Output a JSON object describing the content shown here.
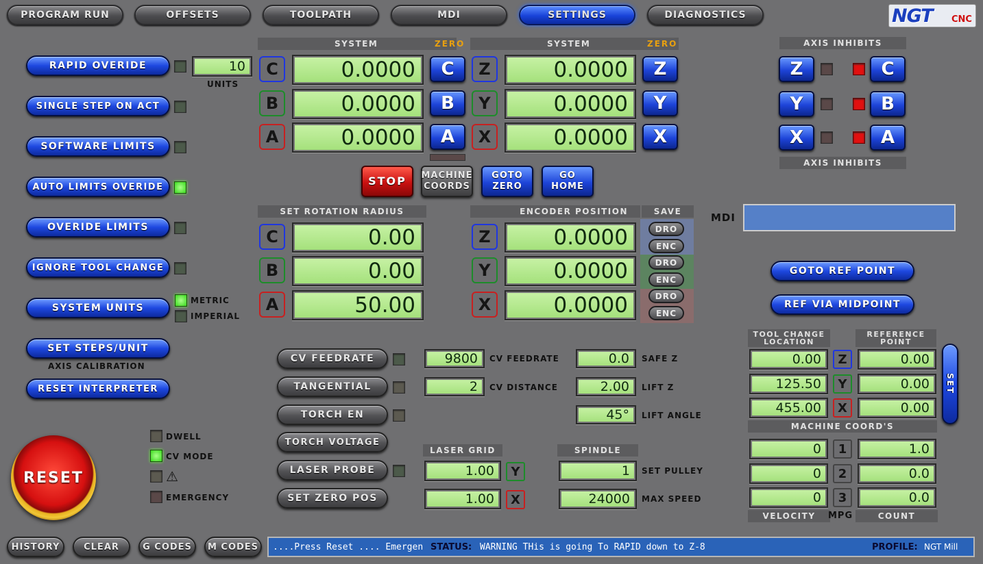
{
  "tabs": [
    "PROGRAM RUN",
    "OFFSETS",
    "TOOLPATH",
    "MDI",
    "SETTINGS",
    "DIAGNOSTICS"
  ],
  "logo": {
    "brand": "NGT",
    "sub": "CNC"
  },
  "left_buttons": [
    "RAPID OVERIDE",
    "SINGLE STEP ON ACT",
    "SOFTWARE LIMITS",
    "AUTO LIMITS OVERIDE",
    "OVERIDE LIMITS",
    "IGNORE TOOL CHANGE",
    "SYSTEM UNITS",
    "SET STEPS/UNIT",
    "RESET INTERPRETER"
  ],
  "rapid_value": "10",
  "units_label": "UNITS",
  "metric": "METRIC",
  "imperial": "IMPERIAL",
  "axis_calibration": "AXIS CALIBRATION",
  "system_label": "SYSTEM",
  "zero_label": "ZERO",
  "axes_left": [
    "C",
    "B",
    "A"
  ],
  "axes_right": [
    "Z",
    "Y",
    "X"
  ],
  "dro_left": [
    "0.0000",
    "0.0000",
    "0.0000"
  ],
  "dro_right": [
    "0.0000",
    "0.0000",
    "0.0000"
  ],
  "axis_inhibits": "AXIS INHIBITS",
  "buttons_mid": {
    "stop": "STOP",
    "machine": "MACHINE COORDS",
    "goto_zero": "GOTO ZERO",
    "go_home": "GO HOME"
  },
  "rotation_hdr": "SET ROTATION RADIUS",
  "rotation_vals": [
    "0.00",
    "0.00",
    "50.00"
  ],
  "encoder_hdr": "ENCODER POSITION",
  "save_hdr": "SAVE",
  "encoder_vals": [
    "0.0000",
    "0.0000",
    "0.0000"
  ],
  "dro_btn": "DRO",
  "enc_btn": "ENC",
  "mdi_label": "MDI",
  "goto_ref": "GOTO REF POINT",
  "ref_mid": "REF VIA MIDPOINT",
  "mid_buttons": [
    "CV FEEDRATE",
    "TANGENTIAL",
    "TORCH EN",
    "TORCH VOLTAGE",
    "LASER PROBE",
    "SET ZERO POS"
  ],
  "cv_feedrate_val": "9800",
  "cv_feedrate_lbl": "CV FEEDRATE",
  "cv_distance_val": "2",
  "cv_distance_lbl": "CV DISTANCE",
  "safe_z_val": "0.0",
  "safe_z_lbl": "SAFE Z",
  "lift_z_val": "2.00",
  "lift_z_lbl": "LIFT Z",
  "lift_angle_val": "45°",
  "lift_angle_lbl": "LIFT ANGLE",
  "laser_grid": "LASER GRID",
  "laser_vals": [
    "1.00",
    "1.00"
  ],
  "laser_axes": [
    "Y",
    "X"
  ],
  "spindle": "SPINDLE",
  "spindle_vals": [
    "1",
    "24000"
  ],
  "set_pulley": "SET PULLEY",
  "max_speed": "MAX SPEED",
  "status_leds": {
    "dwell": "DWELL",
    "cv": "CV MODE",
    "warn": "⚠",
    "emergency": "EMERGENCY"
  },
  "reset": "RESET",
  "tool_change": "TOOL CHANGE LOCATION",
  "reference_point": "REFERENCE POINT",
  "tc_vals": [
    "0.00",
    "125.50",
    "455.00"
  ],
  "ref_vals": [
    "0.00",
    "0.00",
    "0.00"
  ],
  "set_btn": "SET",
  "machine_coords": "MACHINE COORD'S",
  "velocity_vals": [
    "0",
    "0",
    "0"
  ],
  "mpg_nums": [
    "1",
    "2",
    "3"
  ],
  "count_vals": [
    "1.0",
    "0.0",
    "0.0"
  ],
  "velocity": "VELOCITY",
  "mpg": "MPG",
  "count": "COUNT",
  "bottom_buttons": [
    "HISTORY",
    "CLEAR",
    "G CODES",
    "M CODES"
  ],
  "status": {
    "msg": "....Press Reset .... Emergen",
    "label": "STATUS:",
    "text": "WARNING THis is going To RAPID down to Z-8",
    "profile_label": "PROFILE:",
    "profile": "NGT Mill"
  },
  "colors": {
    "accent": "#1e48e0",
    "dro": "#a3e07a",
    "led_on": "#38d81c",
    "inhibit": "#e21010"
  }
}
